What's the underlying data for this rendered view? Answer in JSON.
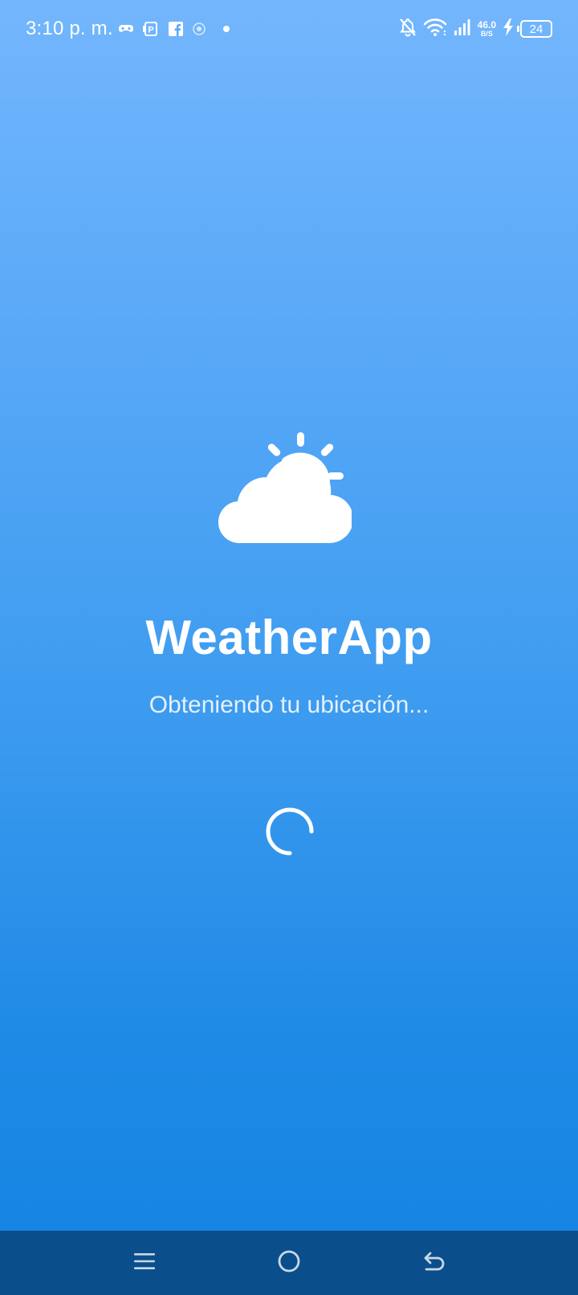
{
  "status_bar": {
    "time": "3:10 p. m.",
    "left_icons": [
      "game-controller-icon",
      "parking-app-icon",
      "facebook-icon",
      "generic-app-icon",
      "notification-dot-icon"
    ],
    "network_speed_value": "46.0",
    "network_speed_unit": "B/S",
    "battery_level": "24",
    "right_icons": [
      "bell-off-icon",
      "wifi-icon",
      "signal-icon",
      "charging-bolt-icon",
      "battery-icon"
    ]
  },
  "main": {
    "logo_icon": "partly-cloudy-icon",
    "title": "WeatherApp",
    "status_text": "Obteniendo tu ubicación...",
    "spinner_icon": "loading-spinner-icon"
  },
  "nav_bar": {
    "buttons": [
      "menu-icon",
      "home-icon",
      "back-icon"
    ]
  },
  "colors": {
    "background_top": "#73b6fd",
    "background_bottom": "#1383e2",
    "nav_bar": "#0a4f8b",
    "foreground": "#ffffff"
  }
}
